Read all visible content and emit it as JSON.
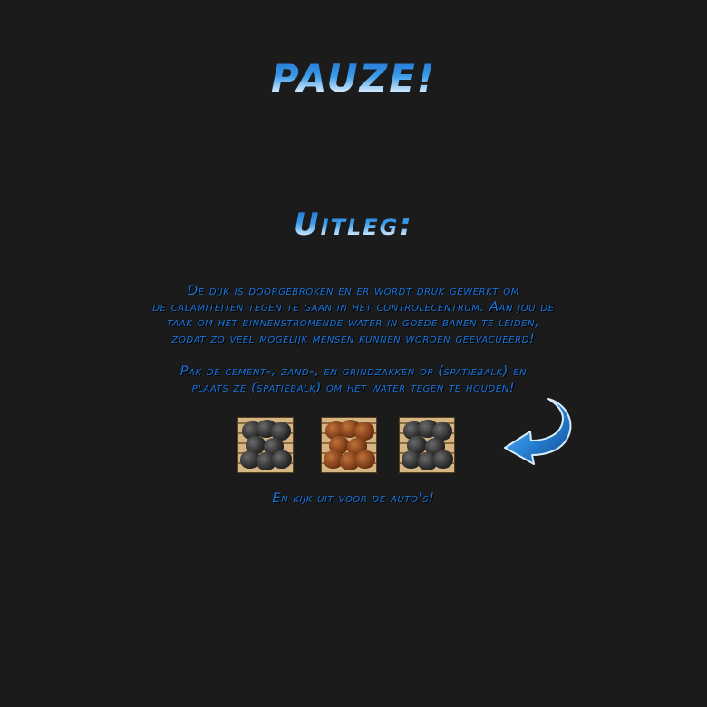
{
  "pause_screen": {
    "title": "PAUZE!",
    "subtitle": "Uitleg:",
    "paragraph1": [
      "De dijk is doorgebroken en er wordt druk gewerkt om",
      "de calamiteiten tegen te gaan in het controlecentrum. Aan jou de",
      "taak om het binnenstromende water in goede banen te leiden,",
      "zodat zo veel mogelijk mensen kunnen worden geevacueerd!"
    ],
    "paragraph2": [
      "Pak de cement-, zand-, en grindzakken op (spatiebalk) en",
      "plaats ze (spatiebalk) om het water tegen te houden!"
    ],
    "footer": "En kijk uit voor de auto's!"
  },
  "items": [
    {
      "type": "cement-bags-icon",
      "color": "#3a3a3a"
    },
    {
      "type": "sand-bags-icon",
      "color": "#8a4a20"
    },
    {
      "type": "gravel-bags-icon",
      "color": "#4a4a4a"
    }
  ],
  "accent_color": "#1f74d4",
  "background_color": "#1b1b1c"
}
